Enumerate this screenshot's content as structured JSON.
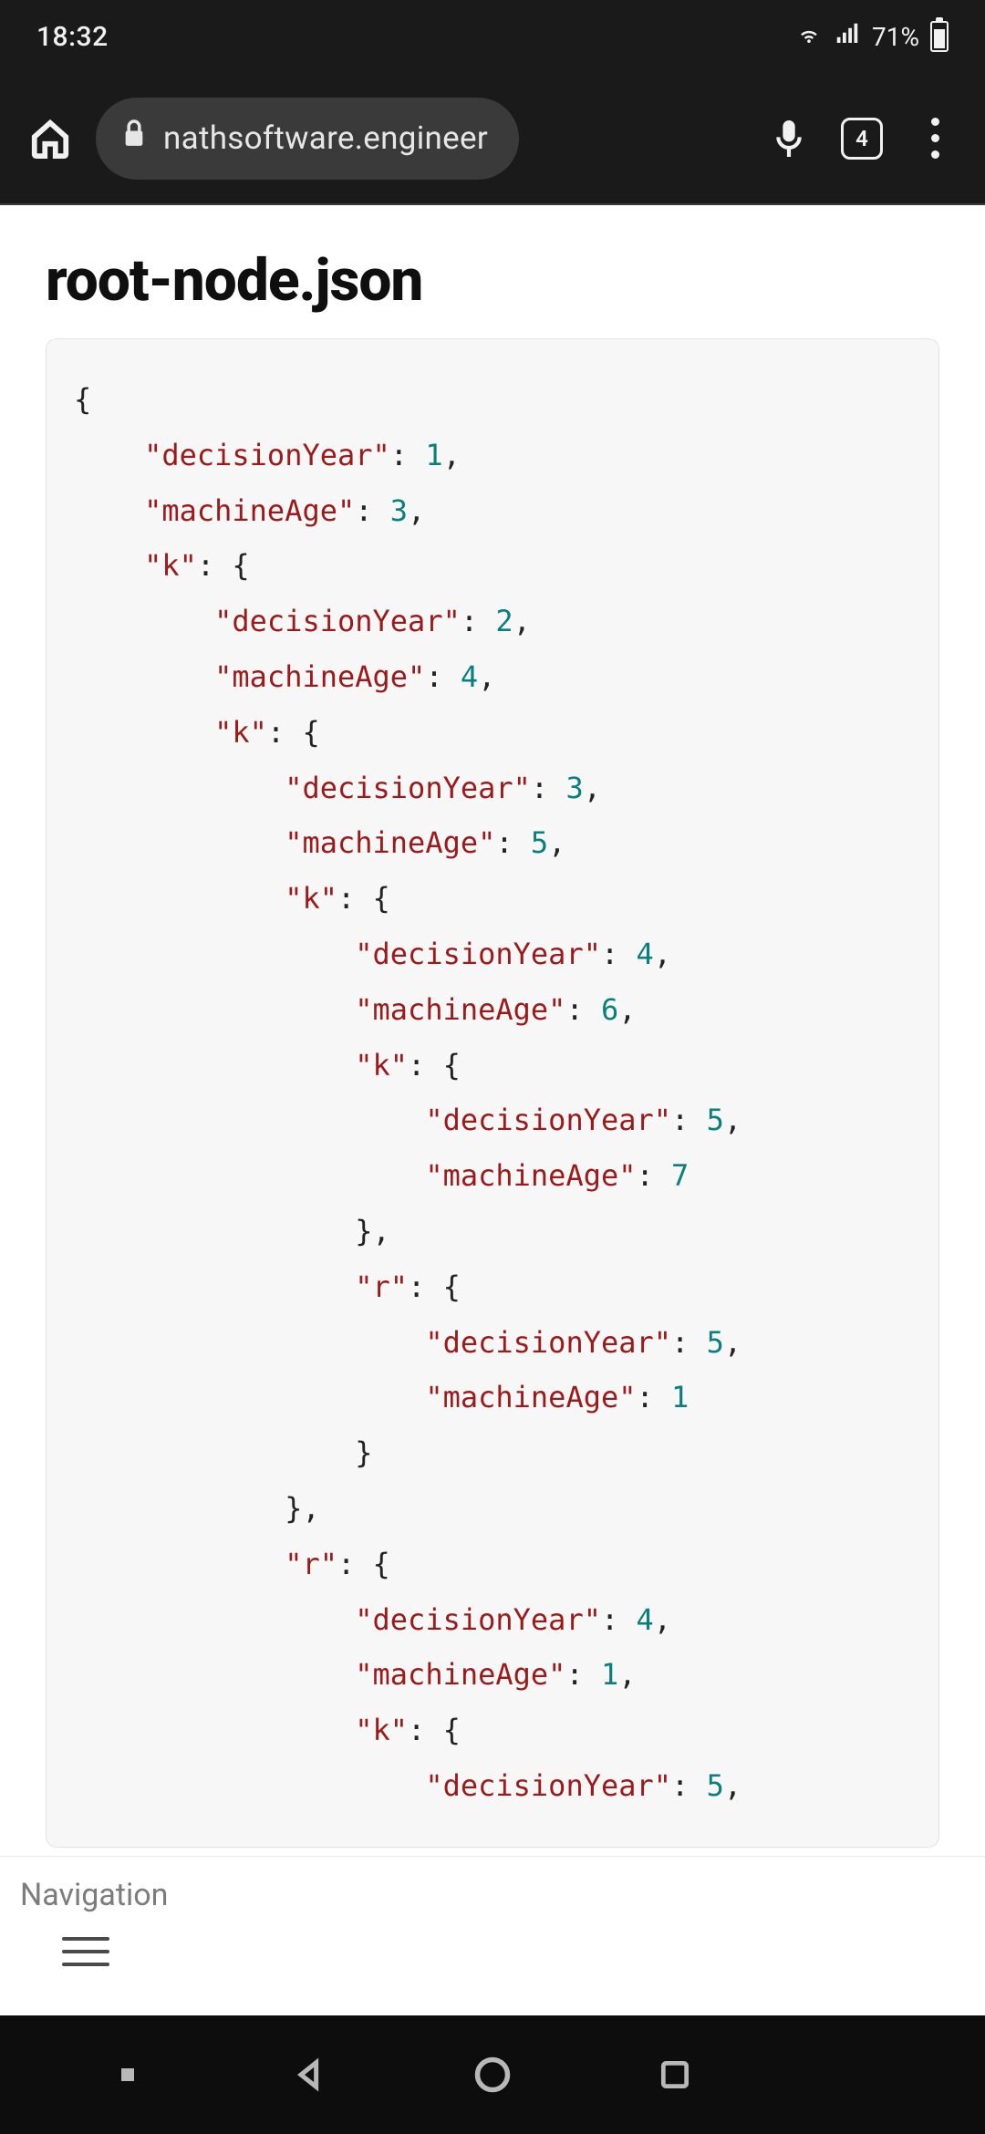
{
  "status": {
    "time": "18:32",
    "battery_pct": "71%"
  },
  "browser": {
    "url_display": "nathsoftware.engineer",
    "tabs_count": "4"
  },
  "page": {
    "title": "root-node.json",
    "nav_label": "Navigation"
  },
  "code": {
    "tokens": [
      [
        "p",
        "{"
      ],
      [
        "nl",
        ""
      ],
      [
        "i",
        1
      ],
      [
        "k",
        "\"decisionYear\""
      ],
      [
        "p",
        ": "
      ],
      [
        "n",
        "1"
      ],
      [
        "p",
        ","
      ],
      [
        "nl",
        ""
      ],
      [
        "i",
        1
      ],
      [
        "k",
        "\"machineAge\""
      ],
      [
        "p",
        ": "
      ],
      [
        "n",
        "3"
      ],
      [
        "p",
        ","
      ],
      [
        "nl",
        ""
      ],
      [
        "i",
        1
      ],
      [
        "k",
        "\"k\""
      ],
      [
        "p",
        ": {"
      ],
      [
        "nl",
        ""
      ],
      [
        "i",
        2
      ],
      [
        "k",
        "\"decisionYear\""
      ],
      [
        "p",
        ": "
      ],
      [
        "n",
        "2"
      ],
      [
        "p",
        ","
      ],
      [
        "nl",
        ""
      ],
      [
        "i",
        2
      ],
      [
        "k",
        "\"machineAge\""
      ],
      [
        "p",
        ": "
      ],
      [
        "n",
        "4"
      ],
      [
        "p",
        ","
      ],
      [
        "nl",
        ""
      ],
      [
        "i",
        2
      ],
      [
        "k",
        "\"k\""
      ],
      [
        "p",
        ": {"
      ],
      [
        "nl",
        ""
      ],
      [
        "i",
        3
      ],
      [
        "k",
        "\"decisionYear\""
      ],
      [
        "p",
        ": "
      ],
      [
        "n",
        "3"
      ],
      [
        "p",
        ","
      ],
      [
        "nl",
        ""
      ],
      [
        "i",
        3
      ],
      [
        "k",
        "\"machineAge\""
      ],
      [
        "p",
        ": "
      ],
      [
        "n",
        "5"
      ],
      [
        "p",
        ","
      ],
      [
        "nl",
        ""
      ],
      [
        "i",
        3
      ],
      [
        "k",
        "\"k\""
      ],
      [
        "p",
        ": {"
      ],
      [
        "nl",
        ""
      ],
      [
        "i",
        4
      ],
      [
        "k",
        "\"decisionYear\""
      ],
      [
        "p",
        ": "
      ],
      [
        "n",
        "4"
      ],
      [
        "p",
        ","
      ],
      [
        "nl",
        ""
      ],
      [
        "i",
        4
      ],
      [
        "k",
        "\"machineAge\""
      ],
      [
        "p",
        ": "
      ],
      [
        "n",
        "6"
      ],
      [
        "p",
        ","
      ],
      [
        "nl",
        ""
      ],
      [
        "i",
        4
      ],
      [
        "k",
        "\"k\""
      ],
      [
        "p",
        ": {"
      ],
      [
        "nl",
        ""
      ],
      [
        "i",
        5
      ],
      [
        "k",
        "\"decisionYear\""
      ],
      [
        "p",
        ": "
      ],
      [
        "n",
        "5"
      ],
      [
        "p",
        ","
      ],
      [
        "nl",
        ""
      ],
      [
        "i",
        5
      ],
      [
        "k",
        "\"machineAge\""
      ],
      [
        "p",
        ": "
      ],
      [
        "n",
        "7"
      ],
      [
        "nl",
        ""
      ],
      [
        "i",
        4
      ],
      [
        "p",
        "},"
      ],
      [
        "nl",
        ""
      ],
      [
        "i",
        4
      ],
      [
        "k",
        "\"r\""
      ],
      [
        "p",
        ": {"
      ],
      [
        "nl",
        ""
      ],
      [
        "i",
        5
      ],
      [
        "k",
        "\"decisionYear\""
      ],
      [
        "p",
        ": "
      ],
      [
        "n",
        "5"
      ],
      [
        "p",
        ","
      ],
      [
        "nl",
        ""
      ],
      [
        "i",
        5
      ],
      [
        "k",
        "\"machineAge\""
      ],
      [
        "p",
        ": "
      ],
      [
        "n",
        "1"
      ],
      [
        "nl",
        ""
      ],
      [
        "i",
        4
      ],
      [
        "p",
        "}"
      ],
      [
        "nl",
        ""
      ],
      [
        "i",
        3
      ],
      [
        "p",
        "},"
      ],
      [
        "nl",
        ""
      ],
      [
        "i",
        3
      ],
      [
        "k",
        "\"r\""
      ],
      [
        "p",
        ": {"
      ],
      [
        "nl",
        ""
      ],
      [
        "i",
        4
      ],
      [
        "k",
        "\"decisionYear\""
      ],
      [
        "p",
        ": "
      ],
      [
        "n",
        "4"
      ],
      [
        "p",
        ","
      ],
      [
        "nl",
        ""
      ],
      [
        "i",
        4
      ],
      [
        "k",
        "\"machineAge\""
      ],
      [
        "p",
        ": "
      ],
      [
        "n",
        "1"
      ],
      [
        "p",
        ","
      ],
      [
        "nl",
        ""
      ],
      [
        "i",
        4
      ],
      [
        "k",
        "\"k\""
      ],
      [
        "p",
        ": {"
      ],
      [
        "nl",
        ""
      ],
      [
        "i",
        5
      ],
      [
        "k",
        "\"decisionYear\""
      ],
      [
        "p",
        ": "
      ],
      [
        "n",
        "5"
      ],
      [
        "p",
        ","
      ],
      [
        "nl",
        ""
      ]
    ],
    "indent_unit": "    "
  }
}
